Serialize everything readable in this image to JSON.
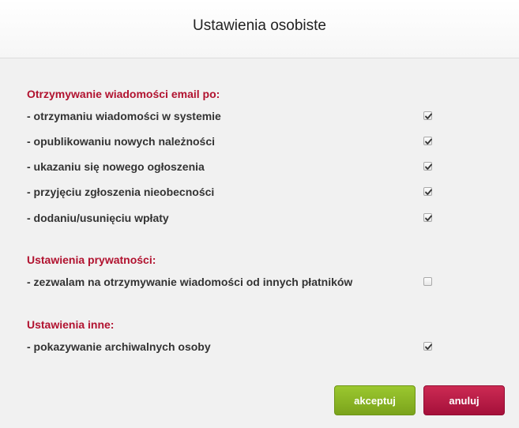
{
  "dialog": {
    "title": "Ustawienia osobiste",
    "sections": [
      {
        "title": "Otrzymywanie wiadomości email po:",
        "options": [
          {
            "label": "- otrzymaniu wiadomości w systemie",
            "checked": true
          },
          {
            "label": "- opublikowaniu nowych należności",
            "checked": true
          },
          {
            "label": "- ukazaniu się nowego ogłoszenia",
            "checked": true
          },
          {
            "label": "- przyjęciu zgłoszenia nieobecności",
            "checked": true
          },
          {
            "label": "- dodaniu/usunięciu wpłaty",
            "checked": true
          }
        ]
      },
      {
        "title": "Ustawienia prywatności:",
        "options": [
          {
            "label": "- zezwalam na otrzymywanie wiadomości od innych płatników",
            "checked": false
          }
        ]
      },
      {
        "title": "Ustawienia inne:",
        "options": [
          {
            "label": "- pokazywanie archiwalnych osoby",
            "checked": true
          }
        ]
      }
    ],
    "buttons": {
      "accept_label": "akceptuj",
      "cancel_label": "anuluj"
    }
  },
  "colors": {
    "section_title": "#b1122f",
    "accept": "#8bb526",
    "cancel": "#b81946"
  }
}
